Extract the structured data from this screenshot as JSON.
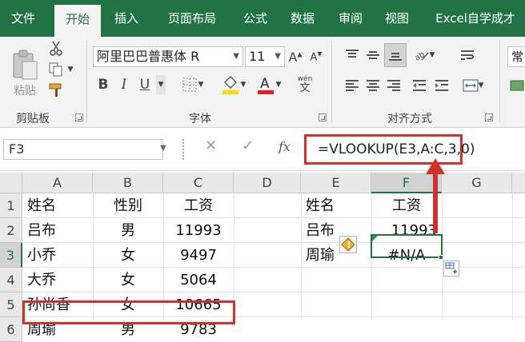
{
  "ribbon_tabs": [
    "文件",
    "开始",
    "插入",
    "页面布局",
    "公式",
    "数据",
    "审阅",
    "视图",
    "Excel自学成才"
  ],
  "clipboard": {
    "paste_label": "粘贴",
    "group_label": "剪贴板"
  },
  "font": {
    "name": "阿里巴巴普惠体 R",
    "size": "11",
    "group_label": "字体",
    "bold": "B",
    "italic": "I",
    "underline": "U",
    "wen": "wén",
    "wen_char": "文"
  },
  "alignment": {
    "group_label": "对齐方式"
  },
  "overflow_label": "常",
  "formula_bar": {
    "name_box": "F3",
    "cancel": "✕",
    "enter": "✓",
    "fx": "fx",
    "formula": "=VLOOKUP(E3,A:C,3,0)"
  },
  "columns": [
    "A",
    "B",
    "C",
    "D",
    "E",
    "F",
    "G"
  ],
  "rows": [
    "1",
    "2",
    "3",
    "4",
    "5",
    "6"
  ],
  "cells": {
    "A": [
      "姓名",
      "吕布",
      "小乔",
      "大乔",
      "孙尚香",
      "周瑜"
    ],
    "B": [
      "性别",
      "男",
      "女",
      "女",
      "女",
      "男"
    ],
    "C": [
      "工资",
      "11993",
      "9497",
      "5064",
      "10665",
      "9783"
    ],
    "E": [
      "姓名",
      "吕布",
      "周瑜"
    ],
    "F": [
      "工资",
      "11993",
      "#N/A"
    ]
  },
  "colors": {
    "excel_green": "#217346",
    "highlight_red": "#d0322b",
    "fill_yellow": "#ffd800",
    "font_red": "#e02020",
    "warning_orange": "#f0b030"
  }
}
